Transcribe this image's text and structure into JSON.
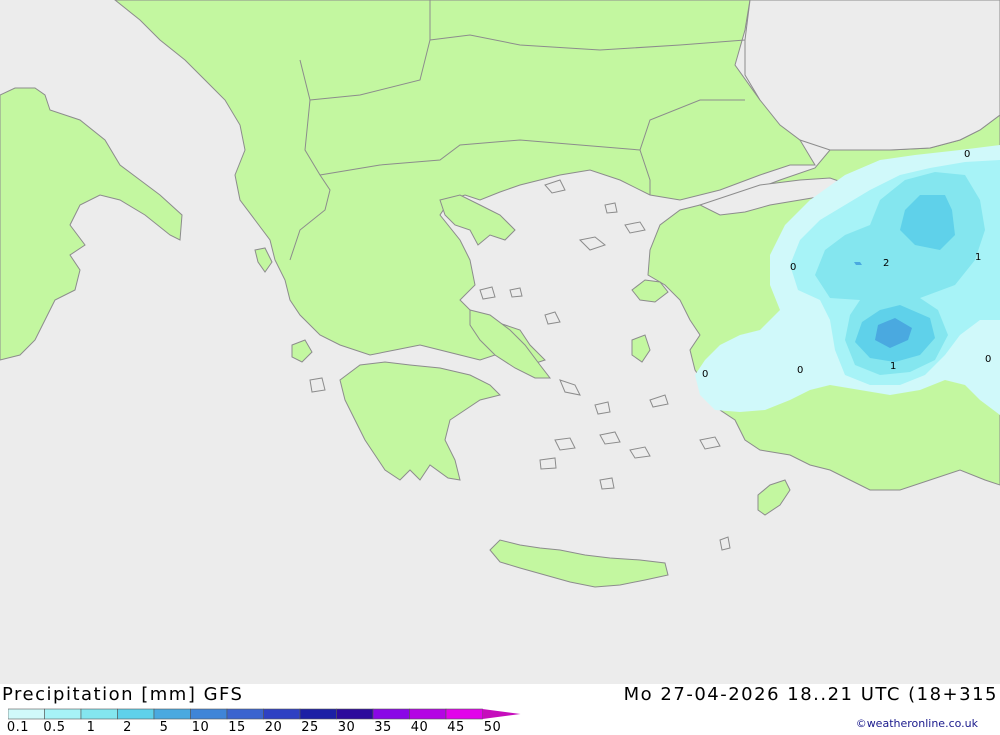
{
  "title": "Precipitation [mm] GFS",
  "datetime": "Mo 27-04-2026 18..21 UTC (18+315",
  "credit": "©weatheronline.co.uk",
  "colors": {
    "sea": "#ececec",
    "land": "#c3f7a0",
    "border": "#8c8c8c",
    "precip": [
      "#d0f9fa",
      "#a7f3f7",
      "#84e6ef",
      "#5fd1ea",
      "#4aa9e0",
      "#3f85d8",
      "#3b64cf",
      "#2e40c3",
      "#1c1fa5",
      "#2c0a9c",
      "#8a07e6",
      "#b405e4",
      "#e203ea",
      "#c60dbc"
    ]
  },
  "legend": {
    "labels": [
      "0.1",
      "0.5",
      "1",
      "2",
      "5",
      "10",
      "15",
      "20",
      "25",
      "30",
      "35",
      "40",
      "45",
      "50"
    ]
  },
  "contour_labels": [
    "0",
    "2",
    "1",
    "0",
    "0",
    "0",
    "1",
    "0"
  ]
}
